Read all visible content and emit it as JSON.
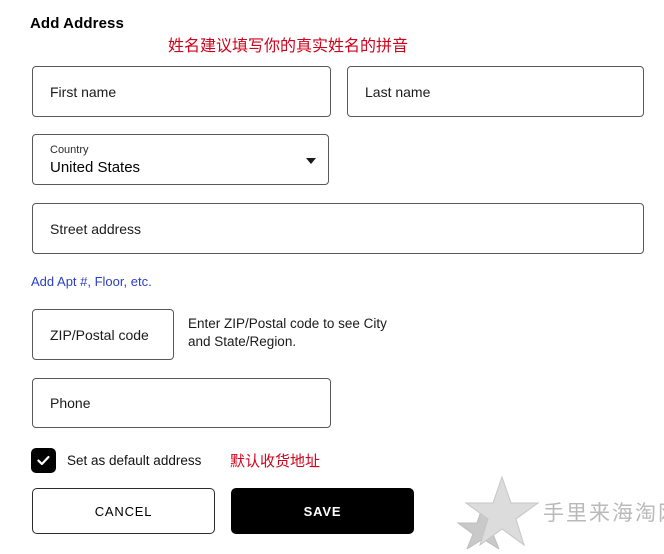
{
  "page": {
    "title": "Add Address"
  },
  "annotations": {
    "name_hint_cn": "姓名建议填写你的真实姓名的拼音",
    "default_address_cn": "默认收货地址",
    "color": "#d0021b"
  },
  "form": {
    "first_name": {
      "name": "first-name",
      "placeholder": "First name",
      "value": ""
    },
    "last_name": {
      "name": "last-name",
      "placeholder": "Last name",
      "value": ""
    },
    "country": {
      "name": "country",
      "label": "Country",
      "value": "United States",
      "options": [
        "United States"
      ],
      "arrow_icon": "chevron-down-icon"
    },
    "street_address": {
      "name": "street-address",
      "placeholder": "Street address",
      "value": ""
    },
    "apt_link": {
      "label": "Add Apt #, Floor, etc.",
      "color": "#2b3fc4"
    },
    "zip": {
      "name": "zip-postal-code",
      "placeholder": "ZIP/Postal code",
      "value": "",
      "helper_text": "Enter ZIP/Postal code to see City and State/Region."
    },
    "phone": {
      "name": "phone",
      "placeholder": "Phone",
      "value": ""
    },
    "default_address": {
      "label": "Set as default address",
      "checked": true,
      "check_icon": "check-icon"
    }
  },
  "actions": {
    "cancel_label": "CANCEL",
    "save_label": "SAVE",
    "save_bg": "#000000",
    "save_fg": "#ffffff"
  },
  "watermark": {
    "text": "手里来海淘网",
    "icon": "two-stars-icon",
    "color": "#b9b9b9"
  }
}
